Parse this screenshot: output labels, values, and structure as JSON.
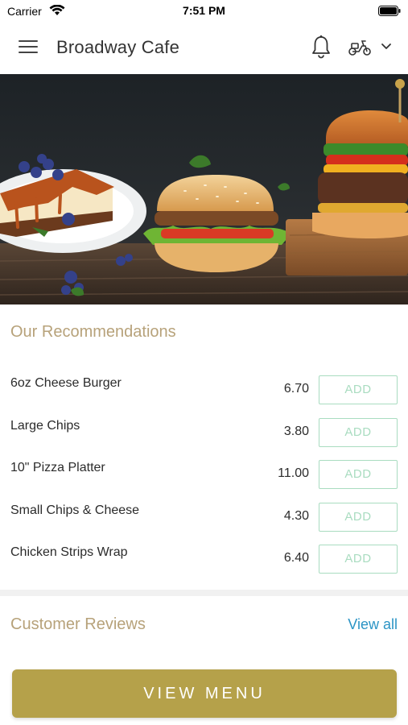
{
  "status_bar": {
    "carrier": "Carrier",
    "time": "7:51 PM"
  },
  "header": {
    "title": "Broadway Cafe",
    "icons": [
      "hamburger-menu-icon",
      "bell-icon",
      "scooter-icon",
      "chevron-down-icon"
    ]
  },
  "hero": {
    "image": "food-banner"
  },
  "recommendations": {
    "title": "Our Recommendations",
    "items": [
      {
        "name": "6oz Cheese Burger",
        "price": "6.70",
        "add_label": "ADD"
      },
      {
        "name": "Large Chips",
        "price": "3.80",
        "add_label": "ADD"
      },
      {
        "name": "10\" Pizza Platter",
        "price": "11.00",
        "add_label": "ADD"
      },
      {
        "name": "Small Chips & Cheese",
        "price": "4.30",
        "add_label": "ADD"
      },
      {
        "name": "Chicken Strips Wrap",
        "price": "6.40",
        "add_label": "ADD"
      }
    ]
  },
  "reviews": {
    "title": "Customer Reviews",
    "view_all": "View all"
  },
  "footer": {
    "view_menu": "VIEW MENU"
  },
  "colors": {
    "accent_gold": "#b5a14a",
    "section_title": "#b7a27a",
    "add_button": "#a9dcc0",
    "link_blue": "#2b94c5"
  }
}
